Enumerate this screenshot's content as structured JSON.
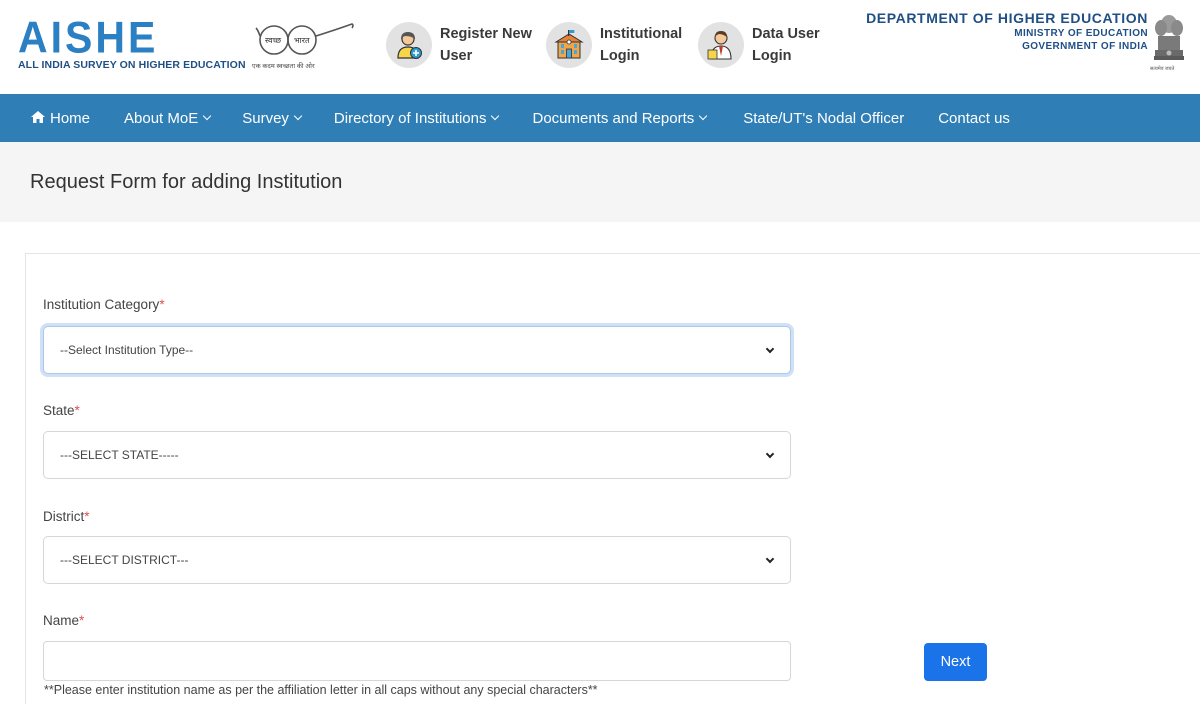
{
  "header": {
    "logo_title": "AISHE",
    "logo_subtitle": "ALL INDIA SURVEY ON HIGHER EDUCATION",
    "swachh_left": "स्वच्छ",
    "swachh_right": "भारत",
    "swachh_caption": "एक कदम स्वच्छता की ओर",
    "quick_links": [
      {
        "line1": "Register New",
        "line2": "User",
        "icon": "register-user-icon"
      },
      {
        "line1": "Institutional",
        "line2": "Login",
        "icon": "institution-building-icon"
      },
      {
        "line1": "Data User",
        "line2": "Login",
        "icon": "data-user-icon"
      }
    ],
    "dept_line1": "DEPARTMENT OF HIGHER EDUCATION",
    "dept_line2": "MINISTRY OF EDUCATION",
    "dept_line3": "GOVERNMENT OF INDIA",
    "emblem_caption": "सत्यमेव जयते"
  },
  "nav": {
    "home": "Home",
    "about": "About MoE",
    "survey": "Survey",
    "directory": "Directory of Institutions",
    "documents": "Documents and Reports",
    "nodal": "State/UT's Nodal Officer",
    "contact": "Contact us"
  },
  "page": {
    "title": "Request Form for adding Institution"
  },
  "form": {
    "category_label": "Institution Category",
    "category_value": "--Select Institution Type--",
    "state_label": "State",
    "state_value": "---SELECT STATE-----",
    "district_label": "District",
    "district_value": "---SELECT DISTRICT---",
    "name_label": "Name",
    "name_value": "",
    "required_mark": "*",
    "name_hint": "**Please enter institution name as per the affiliation letter in all caps without any special characters**",
    "next_label": "Next"
  },
  "colors": {
    "nav_bg": "#2f7fb6",
    "logo_blue": "#2b7fc3",
    "dept_blue": "#1f4f84",
    "primary_button": "#1a73e8",
    "required": "#d9534f"
  }
}
